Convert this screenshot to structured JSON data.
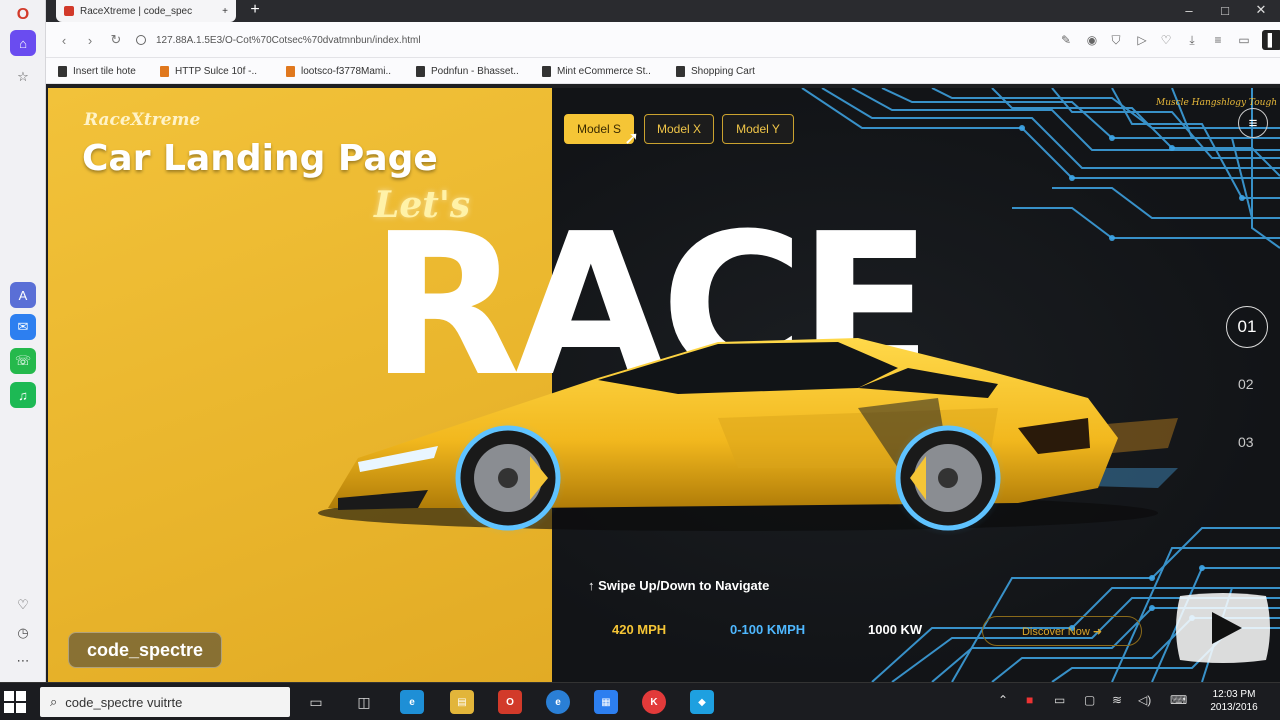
{
  "browser": {
    "tab_title": "RaceXtreme | code_spec",
    "tab_new": "+",
    "new_tab_plus": "+",
    "address": "127.88A.1.5E3/O-Cot%70Cotsec%70dvatmnbun/index.html",
    "bookmarks": [
      {
        "label": "Insert tile hote"
      },
      {
        "label": "HTTP Sulce 10f -.."
      },
      {
        "label": "lootsco-f3778Mami.."
      },
      {
        "label": "Podnfun - Bhasset.."
      },
      {
        "label": "Mint eCommerce St.."
      },
      {
        "label": "Shopping Cart"
      }
    ]
  },
  "page": {
    "brand": "RaceXtreme",
    "title": "Car Landing Page",
    "lets": "Let's",
    "race": "RACE",
    "models": [
      {
        "label": "Model S"
      },
      {
        "label": "Model X"
      },
      {
        "label": "Model Y"
      }
    ],
    "topright_text": "Muscle Hangshlogy Tough",
    "slides": [
      "01",
      "02",
      "03"
    ],
    "swipe_hint": "↑ Swipe Up/Down to Navigate",
    "stats": [
      {
        "label": "420 MPH",
        "color": "#f5c536"
      },
      {
        "label": "0-100 KMPH",
        "color": "#4fb8ff"
      },
      {
        "label": "1000 KW",
        "color": "#ffffff"
      }
    ],
    "discover": "Discover Now ➜",
    "watermark": "code_spectre"
  },
  "colors": {
    "yellow": "#f2c23a",
    "dark": "#15171a",
    "circuit_blue": "#4fb8ff"
  },
  "taskbar": {
    "search_text": "code_spectre vuitrte",
    "apps": [
      "task-view",
      "edge",
      "file-explorer",
      "opera",
      "edge-2",
      "store",
      "kaspersky",
      "app"
    ],
    "clock_time": "12:03 PM",
    "clock_date": "2013/2016"
  }
}
